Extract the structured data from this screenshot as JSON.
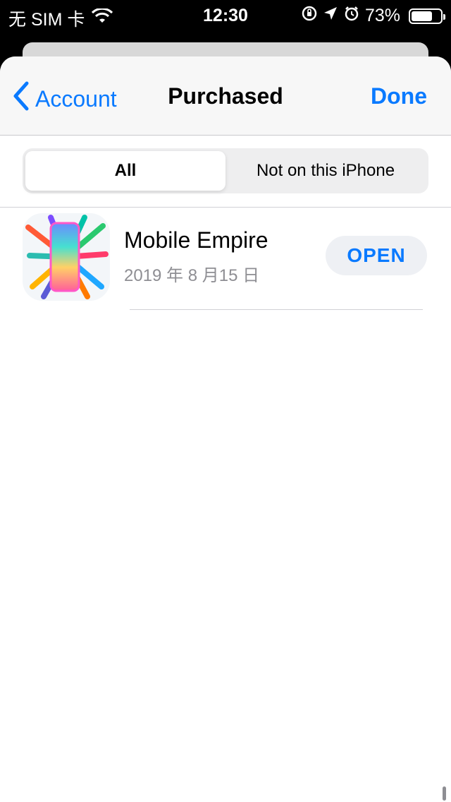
{
  "status_bar": {
    "carrier": "无 SIM 卡",
    "time": "12:30",
    "battery": "73%",
    "battery_level": 0.73
  },
  "nav": {
    "back_label": "Account",
    "title": "Purchased",
    "done_label": "Done"
  },
  "segment": {
    "options": [
      "All",
      "Not on this iPhone"
    ],
    "selected_index": 0
  },
  "list": [
    {
      "name": "Mobile Empire",
      "date": "2019 年 8 月15 日",
      "action_label": "OPEN"
    }
  ],
  "colors": {
    "accent": "#0a7aff",
    "secondary_text": "#8e8e93"
  }
}
